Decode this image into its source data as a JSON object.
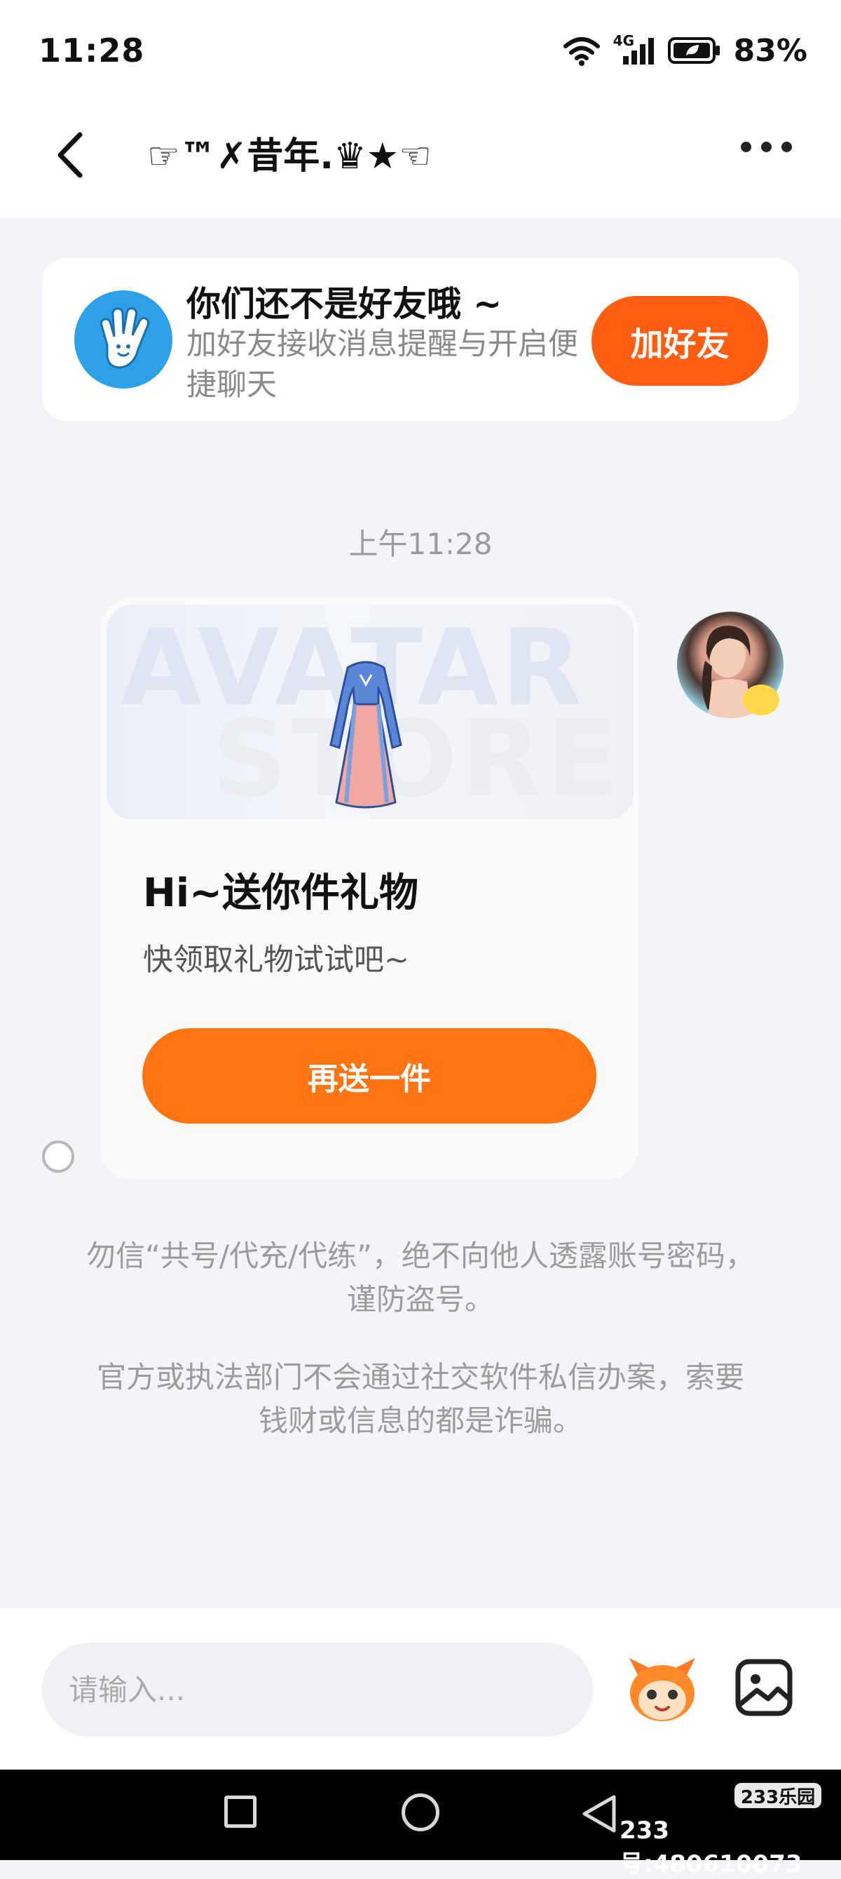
{
  "status_bar": {
    "time": "11:28",
    "network": "4G",
    "battery": "83%"
  },
  "header": {
    "title": "☞™✗昔年.♛★☜"
  },
  "friend_prompt": {
    "title": "你们还不是好友哦 ~",
    "subtitle": "加好友接收消息提醒与开启便捷聊天",
    "button": "加好友"
  },
  "chat": {
    "timestamp": "上午11:28",
    "gift_card": {
      "watermark_line1": "AVATAR",
      "watermark_line2": "STORE",
      "title": "Hi~送你件礼物",
      "subtitle": "快领取礼物试试吧~",
      "button": "再送一件"
    },
    "notice_1": "勿信“共号/代充/代练”，绝不向他人透露账号密码，谨防盗号。",
    "notice_2": "官方或执法部门不会通过社交软件私信办案，索要钱财或信息的都是诈骗。"
  },
  "input": {
    "placeholder": "请输入..."
  },
  "watermark": {
    "logo": "233乐园",
    "id": "233号:480610073"
  },
  "colors": {
    "accent_orange": "#ff5d12",
    "button_orange": "#ff7412",
    "blue_icon": "#2da0e8"
  }
}
